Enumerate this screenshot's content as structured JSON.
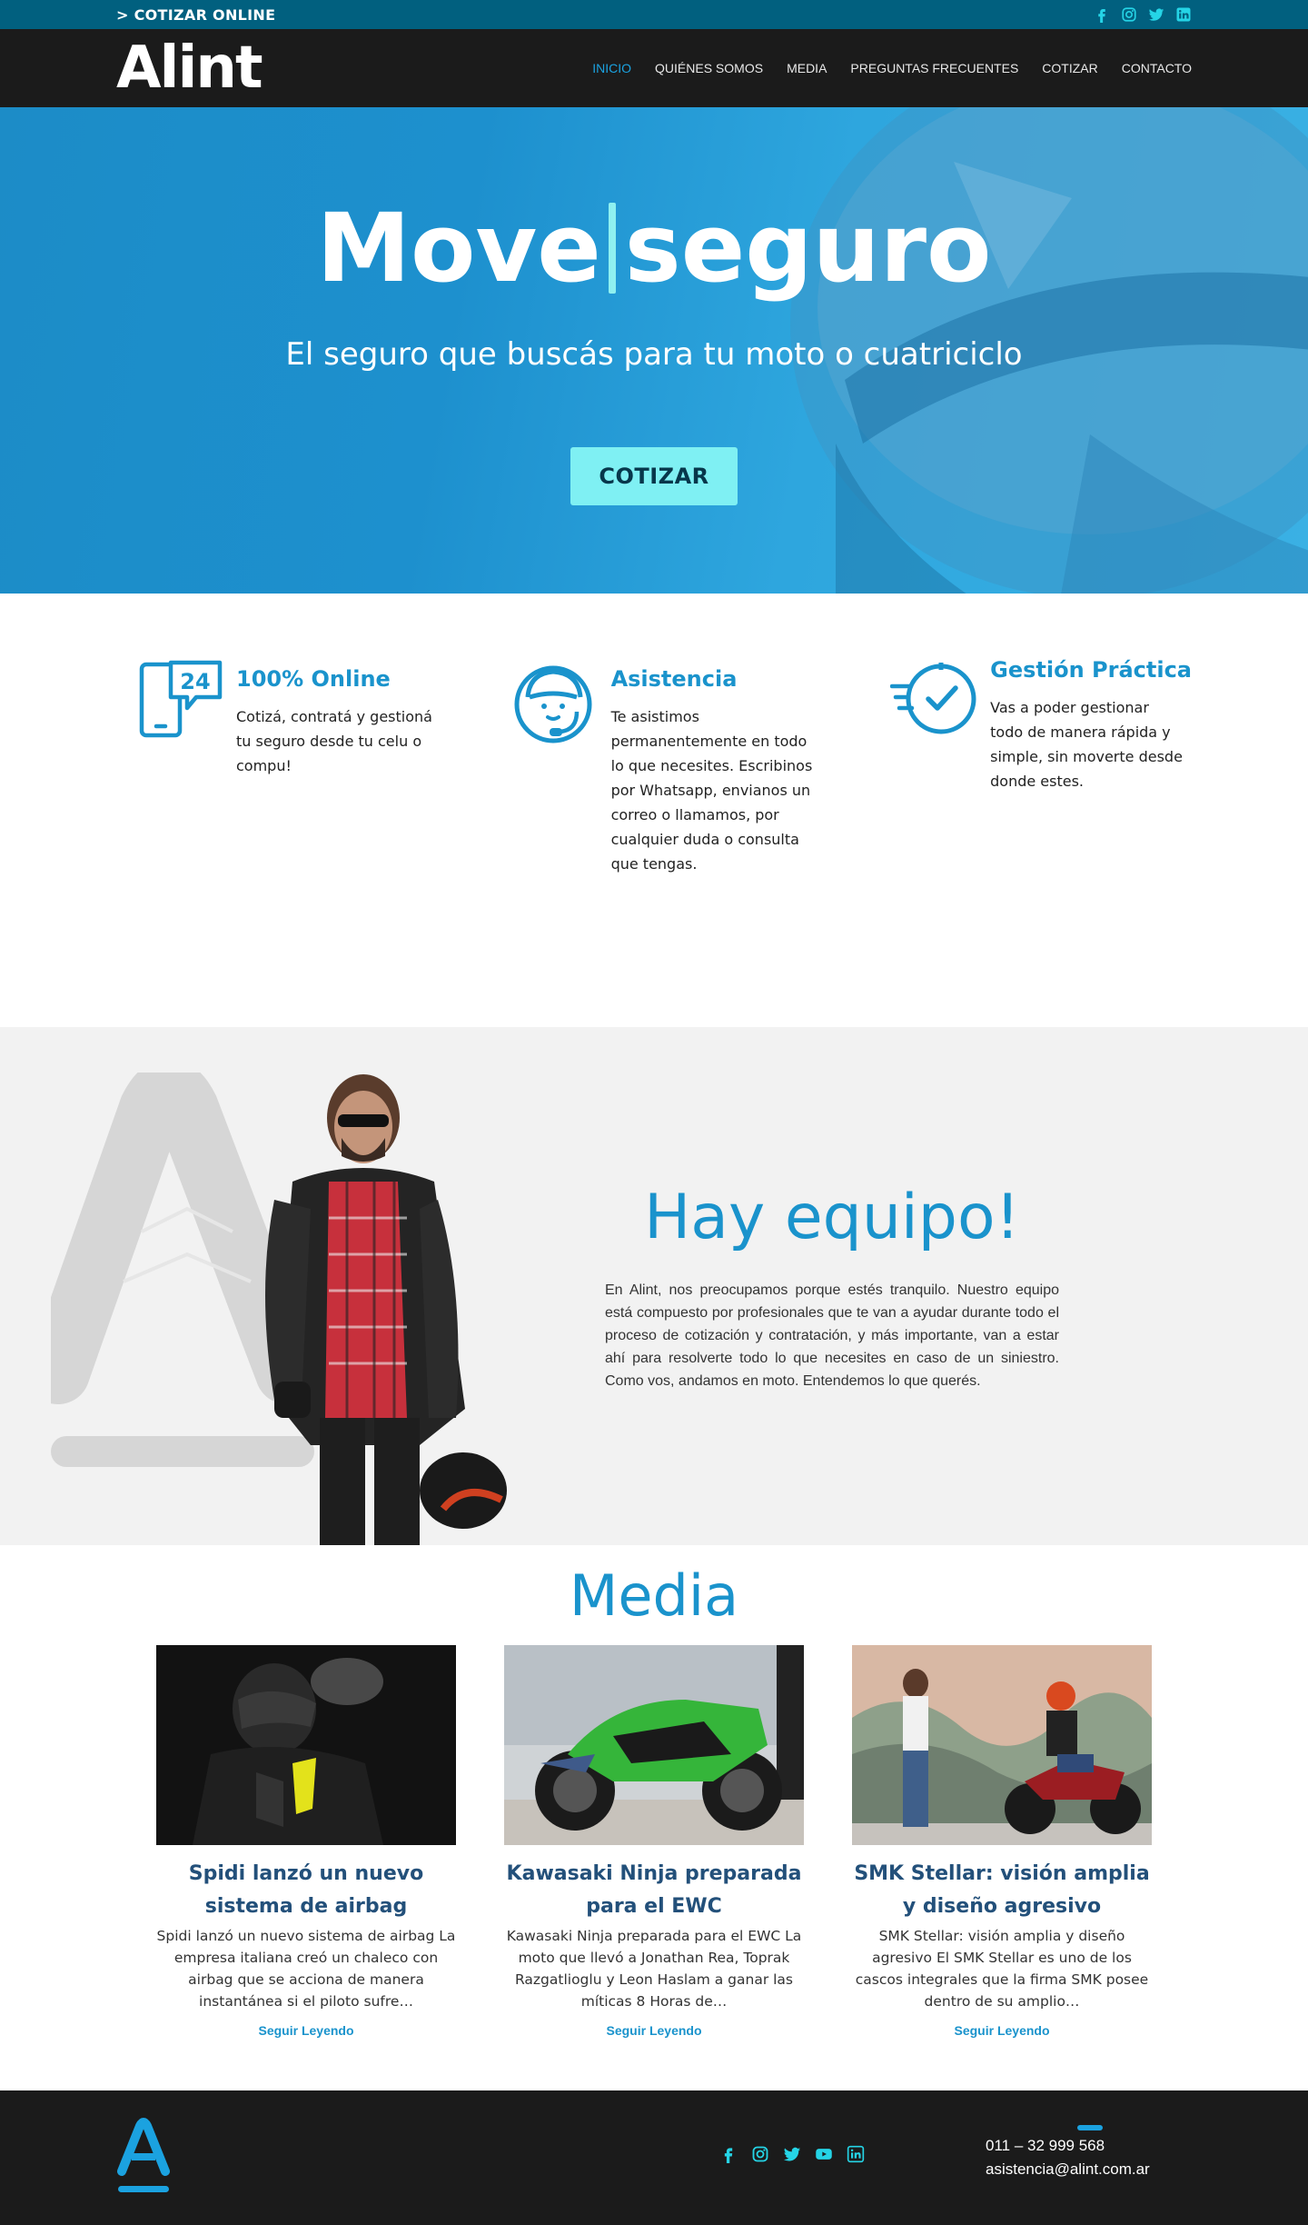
{
  "topbar": {
    "cotizar_online": "> COTIZAR ONLINE",
    "social_icons": [
      "facebook-icon",
      "instagram-icon",
      "twitter-icon",
      "linkedin-icon"
    ],
    "icon_color": "#25d4e6",
    "background": "#01607f"
  },
  "header": {
    "logo": "Alint",
    "nav": [
      {
        "label": "INICIO",
        "active": true
      },
      {
        "label": "QUIÉNES SOMOS",
        "active": false
      },
      {
        "label": "MEDIA",
        "active": false
      },
      {
        "label": "PREGUNTAS FRECUENTES",
        "active": false
      },
      {
        "label": "COTIZAR",
        "active": false
      },
      {
        "label": "CONTACTO",
        "active": false
      }
    ]
  },
  "hero": {
    "title_word1": "Move",
    "title_word2": "seguro",
    "subtitle": "El seguro que buscás para tu moto o cuatriciclo",
    "button": "COTIZAR"
  },
  "features": [
    {
      "icon": "phone-24-icon",
      "title": "100% Online",
      "text": "Cotizá, contratá y gestioná tu seguro desde tu celu o compu!"
    },
    {
      "icon": "headset-agent-icon",
      "title": "Asistencia",
      "text": "Te asistimos permanentemente en todo lo que necesites. Escribinos por Whatsapp, envianos un correo o llamamos, por cualquier duda o consulta que tengas."
    },
    {
      "icon": "fast-clock-check-icon",
      "title": "Gestión Práctica",
      "text": "Vas a poder gestionar todo de manera rápida y simple, sin moverte desde donde estes."
    }
  ],
  "team": {
    "title": "Hay equipo!",
    "text": "En Alint, nos preocupamos porque estés tranquilo. Nuestro equipo está compuesto por profesionales que te van a ayudar durante todo el proceso de cotización y contratación, y más importante, van a estar ahí para resolverte todo lo que necesites en caso de un siniestro. Como vos, andamos en moto. Entendemos lo que querés."
  },
  "media": {
    "title": "Media",
    "articles": [
      {
        "title": "Spidi lanzó un nuevo sistema de airbag",
        "excerpt": "Spidi lanzó un nuevo sistema de airbag La empresa italiana creó un chaleco con airbag que se acciona de manera instantánea si el piloto sufre…",
        "more": "Seguir Leyendo"
      },
      {
        "title": "Kawasaki Ninja preparada para el EWC",
        "excerpt": "Kawasaki Ninja preparada para el EWC La moto que llevó a Jonathan Rea, Toprak Razgatlioglu y Leon Haslam a ganar las míticas 8 Horas de…",
        "more": "Seguir Leyendo"
      },
      {
        "title": "SMK Stellar: visión amplia y diseño agresivo",
        "excerpt": "SMK Stellar: visión amplia y diseño agresivo El SMK Stellar es uno de los cascos integrales que la firma SMK posee dentro de su amplio…",
        "more": "Seguir Leyendo"
      }
    ]
  },
  "footer": {
    "phone": "011 – 32 999 568",
    "email": "asistencia@alint.com.ar",
    "social_icons": [
      "facebook-icon",
      "instagram-icon",
      "twitter-icon",
      "youtube-icon",
      "linkedin-icon"
    ]
  },
  "colors": {
    "brand_blue": "#1a93cc",
    "accent_cyan": "#7ff0f3",
    "dark": "#1b1b1b",
    "article_title": "#23507a"
  }
}
